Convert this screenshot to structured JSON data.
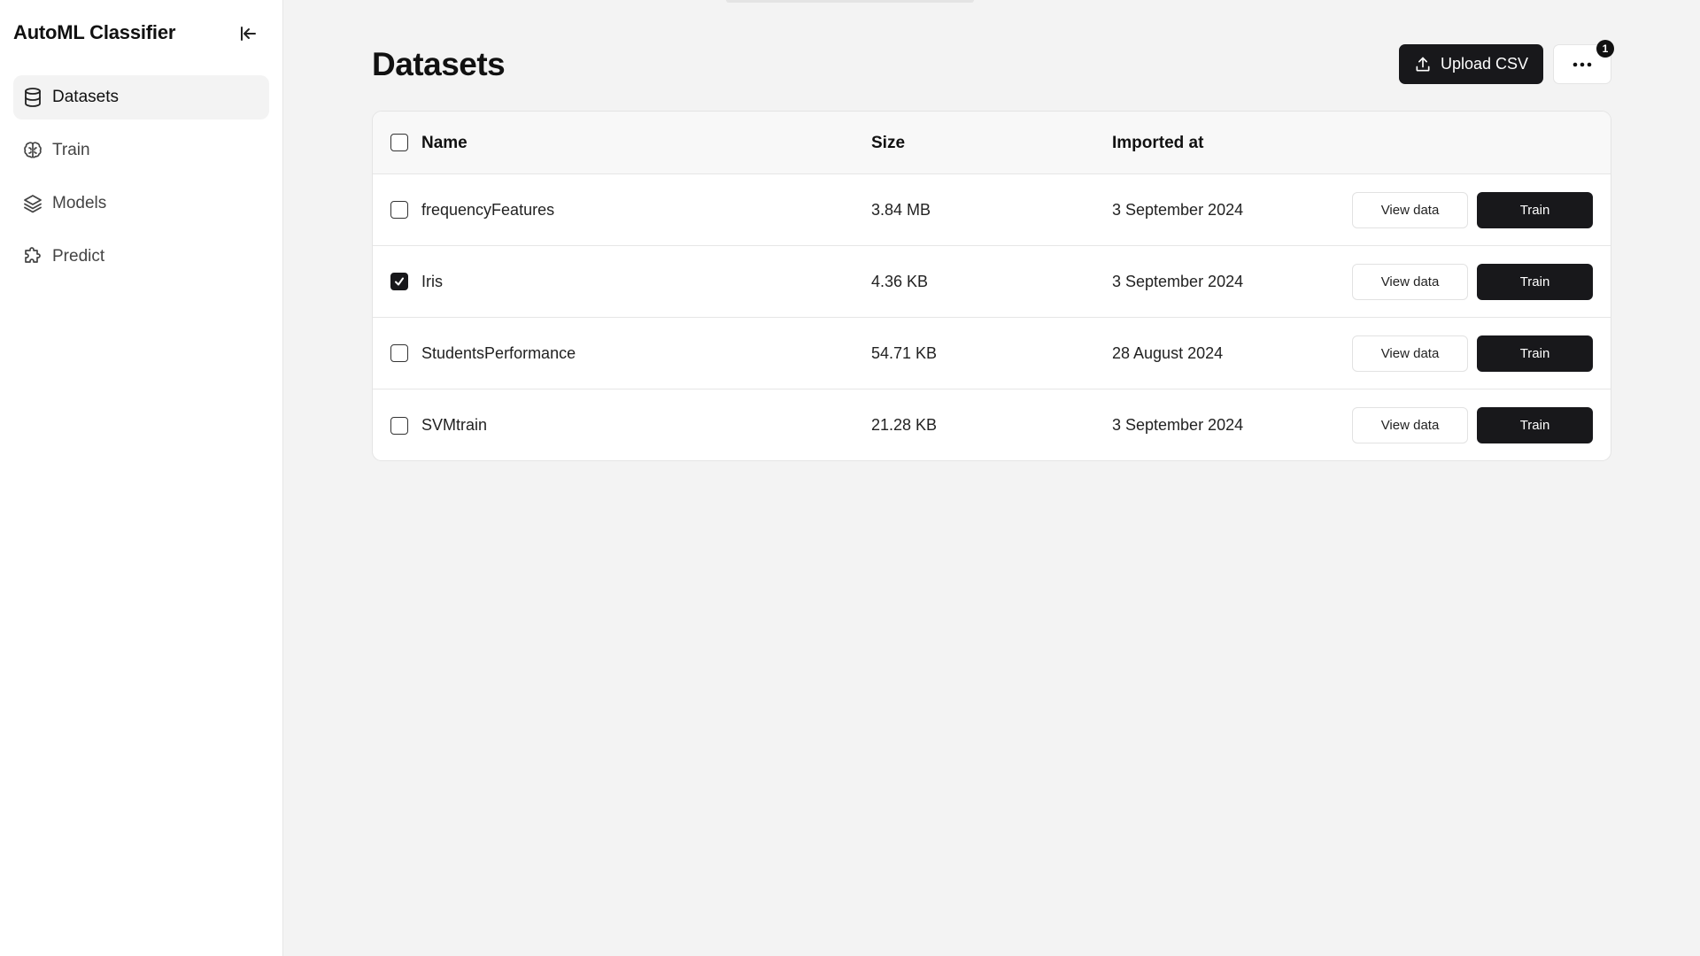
{
  "sidebar": {
    "app_title": "AutoML Classifier",
    "items": [
      {
        "label": "Datasets",
        "icon": "database-icon",
        "active": true
      },
      {
        "label": "Train",
        "icon": "brain-icon",
        "active": false
      },
      {
        "label": "Models",
        "icon": "layers-icon",
        "active": false
      },
      {
        "label": "Predict",
        "icon": "puzzle-icon",
        "active": false
      }
    ]
  },
  "header": {
    "title": "Datasets",
    "upload_label": "Upload CSV",
    "badge_count": "1"
  },
  "table": {
    "columns": {
      "name": "Name",
      "size": "Size",
      "imported": "Imported at"
    },
    "rows": [
      {
        "name": "frequencyFeatures",
        "size": "3.84 MB",
        "imported": "3 September 2024",
        "checked": false,
        "view_label": "View data",
        "train_label": "Train"
      },
      {
        "name": "Iris",
        "size": "4.36 KB",
        "imported": "3 September 2024",
        "checked": true,
        "view_label": "View data",
        "train_label": "Train"
      },
      {
        "name": "StudentsPerformance",
        "size": "54.71 KB",
        "imported": "28 August 2024",
        "checked": false,
        "view_label": "View data",
        "train_label": "Train"
      },
      {
        "name": "SVMtrain",
        "size": "21.28 KB",
        "imported": "3 September 2024",
        "checked": false,
        "view_label": "View data",
        "train_label": "Train"
      }
    ]
  },
  "colors": {
    "primary": "#18181b",
    "background": "#f3f3f3",
    "surface": "#ffffff",
    "border": "#e4e4e4"
  }
}
